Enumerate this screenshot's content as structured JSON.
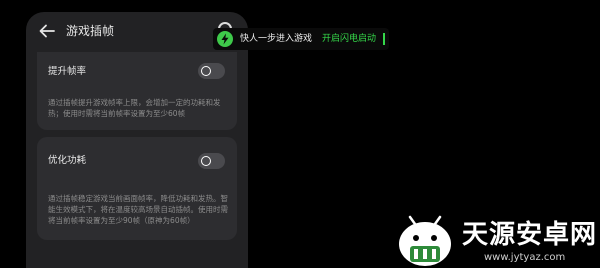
{
  "header": {
    "back_icon": "arrow-left-icon",
    "title": "游戏插帧",
    "corner_icon": "circle-icon"
  },
  "settings": [
    {
      "label": "提升帧率",
      "description": "通过插帧提升游戏帧率上限，会增加一定的功耗和发热；使用时需将当前帧率设置为至少60帧",
      "enabled": false
    },
    {
      "label": "优化功耗",
      "description": "通过插帧稳定游戏当前画面帧率，降低功耗和发热。智能生效模式下，将在温度较高场景自动插帧。使用时需将当前帧率设置为至少90帧（原神为60帧）",
      "enabled": false
    }
  ],
  "toast": {
    "icon": "lightning-icon",
    "message": "快人一步进入游戏",
    "action": "开启闪电启动",
    "color_accent": "#35d84a"
  },
  "watermark": {
    "main": "天源安卓网",
    "sub": "www.jytyaz.com",
    "logo": "android-robot-logo"
  }
}
